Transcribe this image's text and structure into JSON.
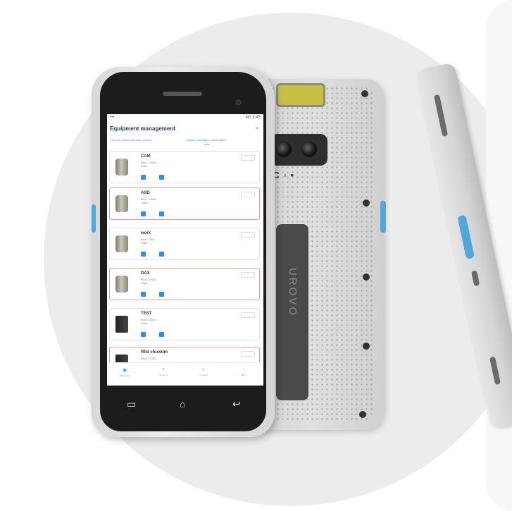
{
  "screen": {
    "status": {
      "left": "•••",
      "right": "4G 3:45"
    },
    "title": "Equipment management",
    "subtitle_left": "Click the card to manage devices",
    "subtitle_right": "Legend: managed / unmanaged",
    "subtitle_link": "view",
    "cards": [
      {
        "name": "CAM",
        "line1": "Bind: 32568",
        "line2": "State: ..."
      },
      {
        "name": "ASD",
        "line1": "Bind: 32568",
        "line2": "State: ..."
      },
      {
        "name": "work",
        "line1": "Bind: 7668",
        "line2": "State: ..."
      },
      {
        "name": "DAX",
        "line1": "Bind: 32568",
        "line2": "State: ..."
      },
      {
        "name": "TEST",
        "line1": "Bind: 32660",
        "line2": "State: ..."
      },
      {
        "name": "Rfid chunklm",
        "line1": "Bind: 37488",
        "line2": ""
      }
    ],
    "nav": [
      {
        "icon": "home-icon",
        "label": "Equipment"
      },
      {
        "icon": "plus-icon",
        "label": "Services"
      },
      {
        "icon": "people-icon",
        "label": "Contacts"
      },
      {
        "icon": "person-icon",
        "label": "Mine"
      }
    ]
  },
  "device_back": {
    "nfc_label": "NFC",
    "brand": "UROVO"
  },
  "hardware_keys": {
    "menu": "▭",
    "home": "⌂",
    "back": "↩"
  },
  "colors": {
    "accent": "#3a8be0",
    "selected_border": "#e49a9a",
    "scan_window": "#c9bf44",
    "side_button": "#4fa8d8"
  }
}
